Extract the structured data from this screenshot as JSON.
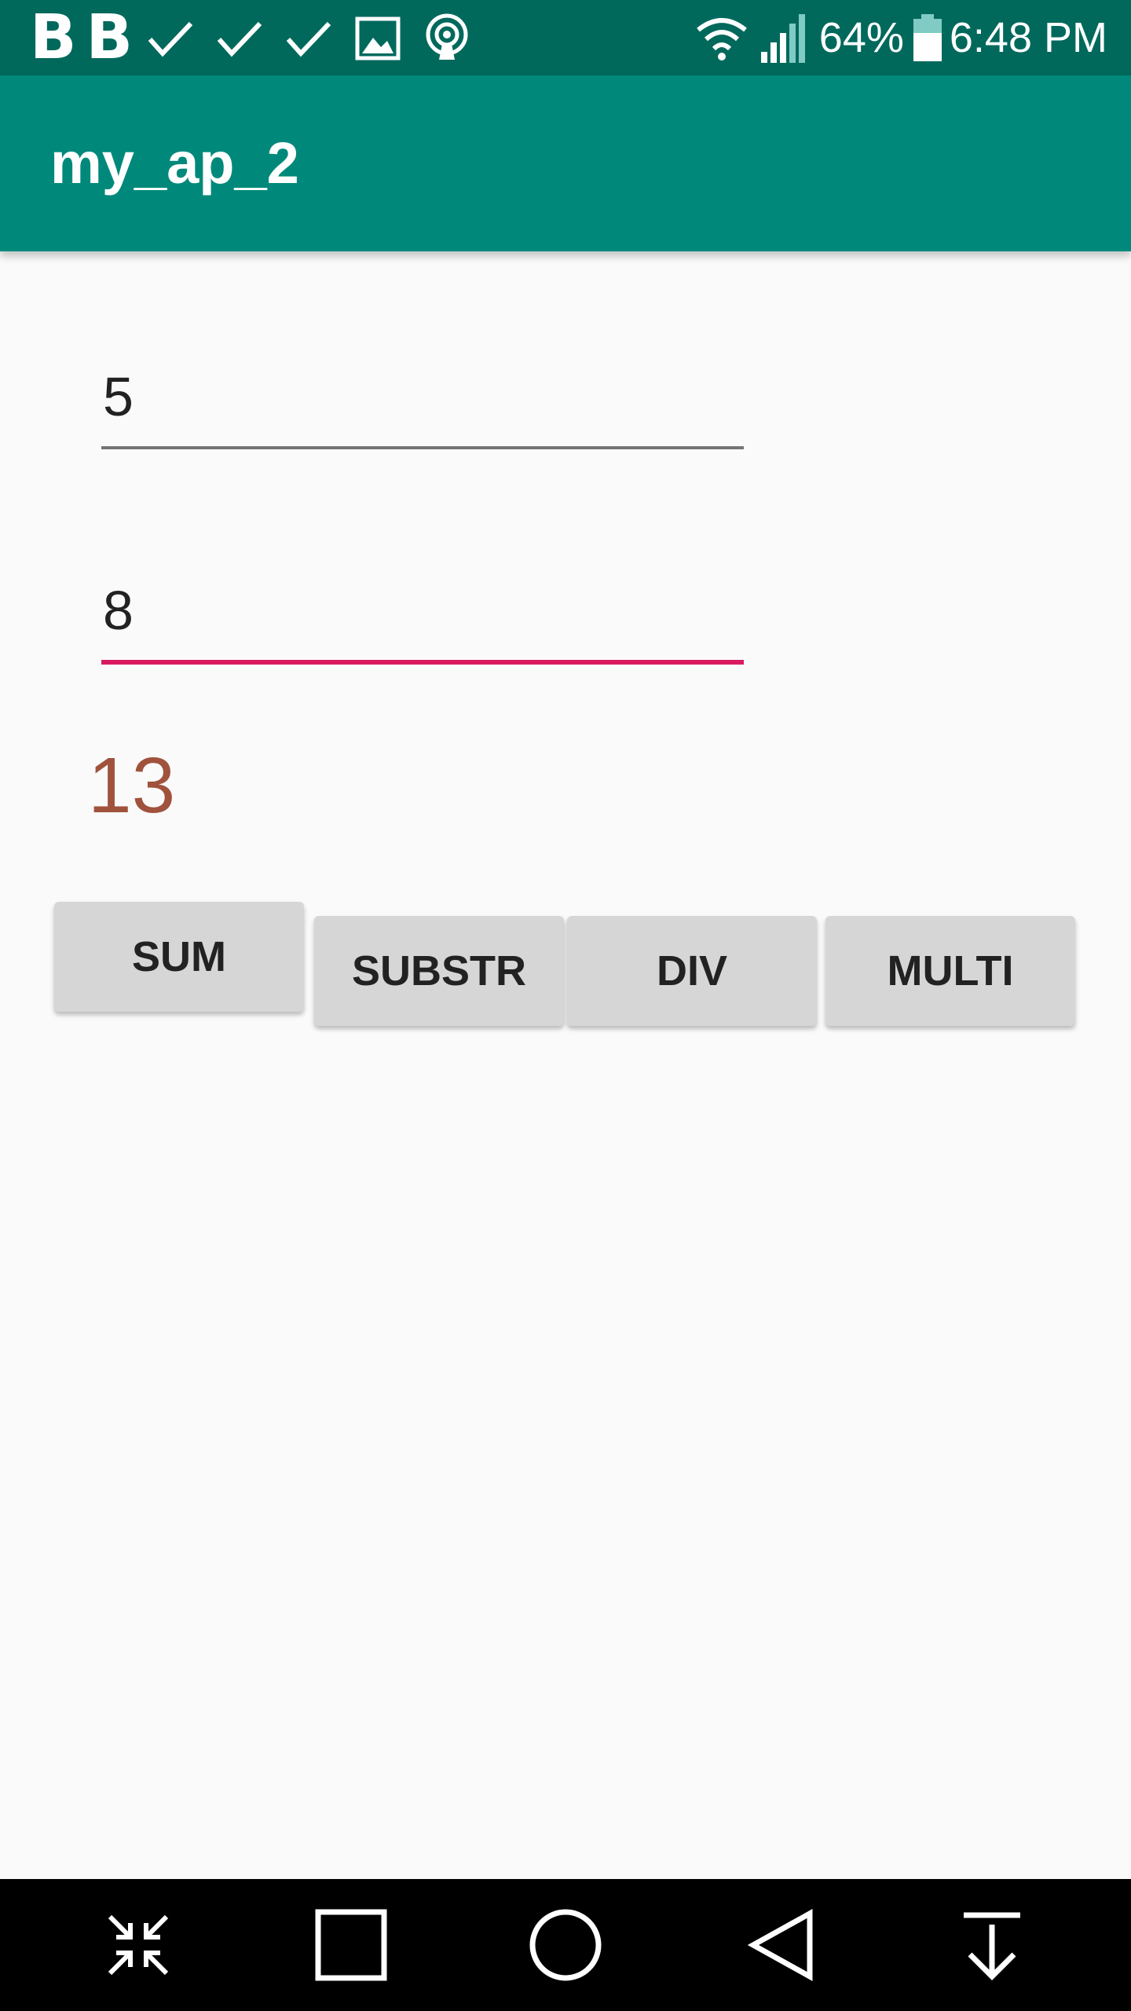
{
  "status_bar": {
    "left_icons": [
      "b-badge-icon",
      "b-badge-icon",
      "check-icon",
      "check-icon",
      "check-icon",
      "image-icon",
      "podcast-icon"
    ],
    "b_letter": "B",
    "battery_percent": "64%",
    "time": "6:48 PM"
  },
  "app_bar": {
    "title": "my_ap_2"
  },
  "form": {
    "first_number": "5",
    "second_number": "8",
    "result": "13"
  },
  "buttons": {
    "sum": "SUM",
    "substr": "SUBSTR",
    "div": "DIV",
    "multi": "MULTI"
  },
  "nav_bar": {
    "icons": [
      "minimize-arrows-icon",
      "recents-square-icon",
      "home-circle-icon",
      "back-triangle-icon",
      "notification-pull-down-icon"
    ]
  },
  "colors": {
    "status_bar": "#00695C",
    "app_bar": "#00897B",
    "accent_underline": "#D81B60",
    "result_text": "#A0523D",
    "button_bg": "#D6D6D6",
    "background": "#FAFAFA"
  }
}
